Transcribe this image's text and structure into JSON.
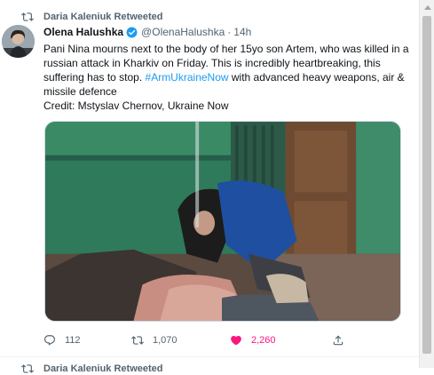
{
  "retweet_banner": {
    "label": "Daria Kaleniuk Retweeted"
  },
  "author": {
    "name": "Olena Halushka",
    "handle": "@OlenaHalushka",
    "separator": "·",
    "time": "14h"
  },
  "tweet": {
    "text_before": "Pani Nina mourns next to the body of her 15yo son Artem, who was killed in a russian attack in Kharkiv on Friday. This is incredibly heartbreaking, this suffering has to stop. ",
    "hashtag": "#ArmUkraineNow",
    "text_after": " with advanced heavy weapons, air & missile defence",
    "credit": "Credit: Mstyslav Chernov, Ukraine Now"
  },
  "actions": {
    "replies": "112",
    "retweets": "1,070",
    "likes": "2,260"
  },
  "next_item": {
    "label": "Daria Kaleniuk Retweeted"
  },
  "colors": {
    "accent": "#1d9bf0",
    "like": "#f91880",
    "retweet_green": "#00ba7c",
    "muted_text": "#536471",
    "wall_green": "#2f7a5a"
  },
  "icons": [
    "retweet-icon",
    "verified-badge-icon",
    "reply-icon",
    "heart-icon",
    "share-icon"
  ]
}
